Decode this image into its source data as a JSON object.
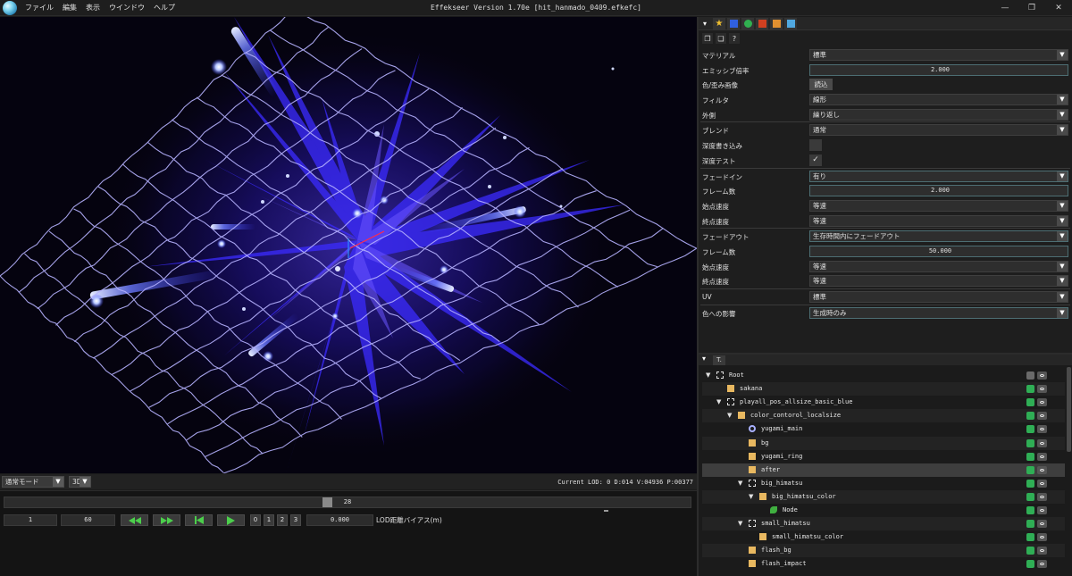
{
  "titlebar": {
    "title": "Effekseer Version 1.70e [hit_hanmado_0409.efkefc]",
    "menu": [
      "ファイル",
      "編集",
      "表示",
      "ウインドウ",
      "ヘルプ"
    ],
    "buttons": [
      "—",
      "❐",
      "✕"
    ]
  },
  "viewbar": {
    "mode": "通常モード",
    "dimension": "3D",
    "lod_info": "Current LOD: 0  D:014  V:04936  P:00377"
  },
  "timeline": {
    "current_frame": "28",
    "current_fraction": 0.47,
    "start_frame": "1",
    "end_frame": "60",
    "lod_buttons": [
      "0",
      "1",
      "2",
      "3"
    ],
    "lod_bias": "0.000",
    "lod_bias_label": "LOD距離バイアス(m)"
  },
  "inspector": {
    "rows": [
      {
        "label": "マテリアル",
        "kind": "combo",
        "value": "標準"
      },
      {
        "label": "エミッシブ倍率",
        "kind": "number",
        "value": "2.000"
      },
      {
        "label": "色/歪み画像",
        "kind": "button",
        "value": "読込"
      },
      {
        "label": "フィルタ",
        "kind": "combo",
        "value": "線形"
      },
      {
        "label": "外側",
        "kind": "combo",
        "value": "繰り返し"
      },
      {
        "label": "ブレンド",
        "kind": "combo",
        "value": "通常",
        "sep": true
      },
      {
        "label": "深度書き込み",
        "kind": "check",
        "value": ""
      },
      {
        "label": "深度テスト",
        "kind": "check",
        "value": "✓"
      },
      {
        "label": "フェードイン",
        "kind": "combo",
        "value": "有り",
        "sep": true
      },
      {
        "label": "フレーム数",
        "kind": "number",
        "value": "2.000"
      },
      {
        "label": "始点速度",
        "kind": "combo",
        "value": "等速"
      },
      {
        "label": "終点速度",
        "kind": "combo",
        "value": "等速"
      },
      {
        "label": "フェードアウト",
        "kind": "combo",
        "value": "生存時間内にフェードアウト",
        "sep": true
      },
      {
        "label": "フレーム数",
        "kind": "number",
        "value": "50.000"
      },
      {
        "label": "始点速度",
        "kind": "combo",
        "value": "等速"
      },
      {
        "label": "終点速度",
        "kind": "combo",
        "value": "等速"
      },
      {
        "label": "UV",
        "kind": "combo",
        "value": "標準",
        "sep": true
      },
      {
        "label": "色への影響",
        "kind": "combo",
        "value": "生成時のみ",
        "sep": true
      }
    ]
  },
  "node_tab": "T.",
  "nodes": [
    {
      "label": "Root",
      "depth": 0,
      "twisty": "▼",
      "icon": "dotted-box",
      "vis": false
    },
    {
      "label": "sakana",
      "depth": 1,
      "twisty": "",
      "icon": "folder",
      "vis": true
    },
    {
      "label": "playall_pos_allsize_basic_blue",
      "depth": 1,
      "twisty": "▼",
      "icon": "dotted-box",
      "vis": true
    },
    {
      "label": "color_contorol_localsize",
      "depth": 2,
      "twisty": "▼",
      "icon": "folder",
      "vis": true
    },
    {
      "label": "yugami_main",
      "depth": 3,
      "twisty": "",
      "icon": "ring",
      "vis": true
    },
    {
      "label": "bg",
      "depth": 3,
      "twisty": "",
      "icon": "folder",
      "vis": true
    },
    {
      "label": "yugami_ring",
      "depth": 3,
      "twisty": "",
      "icon": "folder",
      "vis": true
    },
    {
      "label": "after",
      "depth": 3,
      "twisty": "",
      "icon": "folder",
      "vis": true,
      "selected": true
    },
    {
      "label": "big_himatsu",
      "depth": 3,
      "twisty": "▼",
      "icon": "dotted-box",
      "vis": true
    },
    {
      "label": "big_himatsu_color",
      "depth": 4,
      "twisty": "▼",
      "icon": "folder",
      "vis": true
    },
    {
      "label": "Node",
      "depth": 5,
      "twisty": "",
      "icon": "leaf",
      "vis": true
    },
    {
      "label": "small_himatsu",
      "depth": 3,
      "twisty": "▼",
      "icon": "dotted-box",
      "vis": true
    },
    {
      "label": "small_himatsu_color",
      "depth": 4,
      "twisty": "",
      "icon": "folder",
      "vis": true
    },
    {
      "label": "flash_bg",
      "depth": 3,
      "twisty": "",
      "icon": "folder",
      "vis": true
    },
    {
      "label": "flash_impact",
      "depth": 3,
      "twisty": "",
      "icon": "folder",
      "vis": true
    }
  ]
}
